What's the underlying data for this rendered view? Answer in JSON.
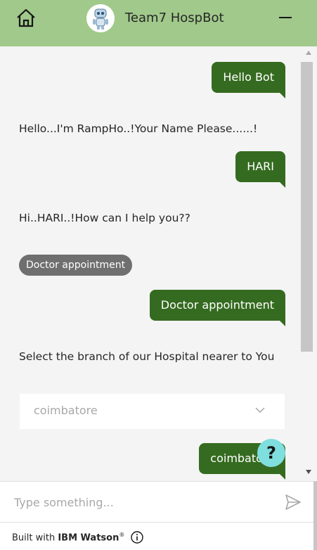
{
  "header": {
    "title": "Team7 HospBot",
    "home_icon": "home-icon",
    "minimize_icon": "minimize-icon",
    "avatar_icon": "robot-avatar-icon",
    "background": "#a1c98b"
  },
  "messages": [
    {
      "from": "user",
      "text": "Hello Bot"
    },
    {
      "from": "bot",
      "text": "Hello...I'm RampHo..!Your Name Please......!"
    },
    {
      "from": "user",
      "text": "HARI"
    },
    {
      "from": "bot",
      "text": "Hi..HARI..!How can I help you??"
    },
    {
      "from": "bot-option",
      "text": "Doctor appointment"
    },
    {
      "from": "user",
      "text": "Doctor appointment"
    },
    {
      "from": "bot",
      "text": "Select the branch of our Hospital nearer to You"
    },
    {
      "from": "bot-dropdown",
      "text": "coimbatore"
    },
    {
      "from": "user",
      "text": "coimbatore"
    }
  ],
  "help_button": {
    "label": "?",
    "color": "#7fdede"
  },
  "composer": {
    "placeholder": "Type something...",
    "send_icon": "send-icon"
  },
  "footer": {
    "prefix": "Built with",
    "brand": "IBM Watson",
    "trademark": "®",
    "info_icon": "info-icon"
  },
  "colors": {
    "user_bubble": "#356b20",
    "option_chip": "#6f6f6f"
  }
}
